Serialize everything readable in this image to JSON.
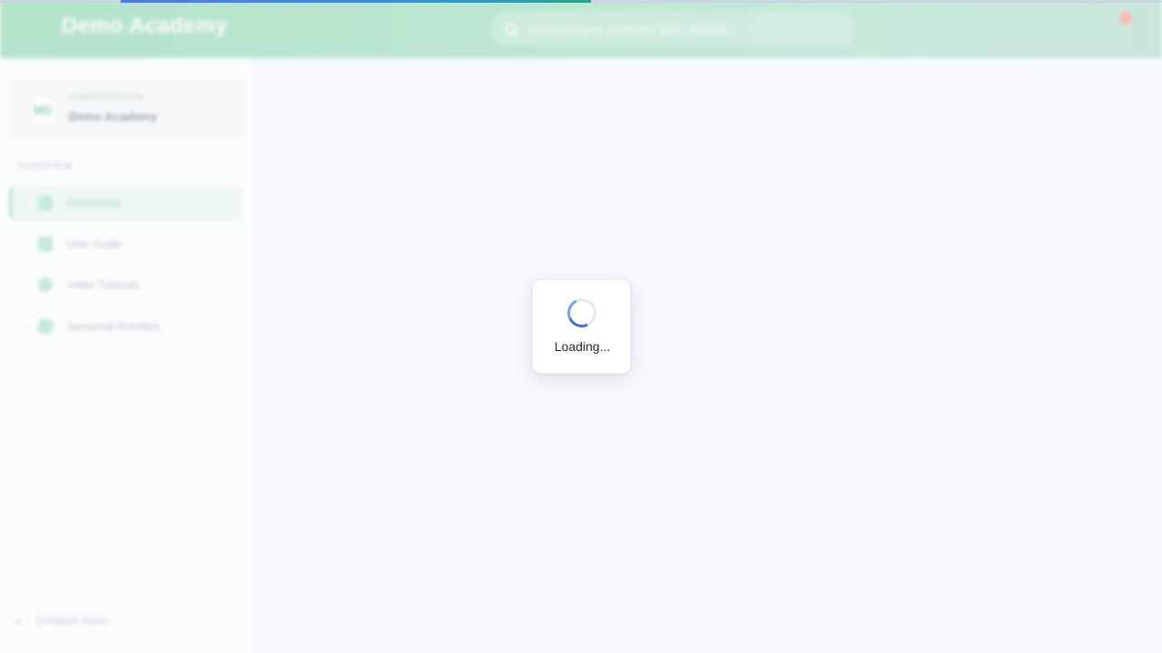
{
  "header": {
    "title": "Demo Academy",
    "search_placeholder": "Search pages, students, staff, classes..."
  },
  "progress": {
    "percent": 40.5,
    "gradient_start": "#4f7be8",
    "gradient_end": "#2fa38a"
  },
  "sidebar": {
    "org": {
      "subtitle": "ADMINISTRATION",
      "name": "Demo Academy",
      "logo_text": "MD"
    },
    "section_label": "OVERVIEW",
    "items": [
      {
        "label": "Dashboard",
        "icon": "home-icon",
        "active": true
      },
      {
        "label": "User Guide",
        "icon": "book-icon",
        "active": false
      },
      {
        "label": "Video Tutorials",
        "icon": "play-circle-icon",
        "active": false
      },
      {
        "label": "Sessional Activities",
        "icon": "clipboard-icon",
        "active": false,
        "expandable": true
      }
    ],
    "collapse_label": "Collapse menu"
  },
  "loading": {
    "text": "Loading..."
  },
  "colors": {
    "topbar": "#8fd8b0",
    "accent_green": "#5ebc8a",
    "spinner_blue": "#3f6fd6",
    "notification": "#ff8a80"
  }
}
